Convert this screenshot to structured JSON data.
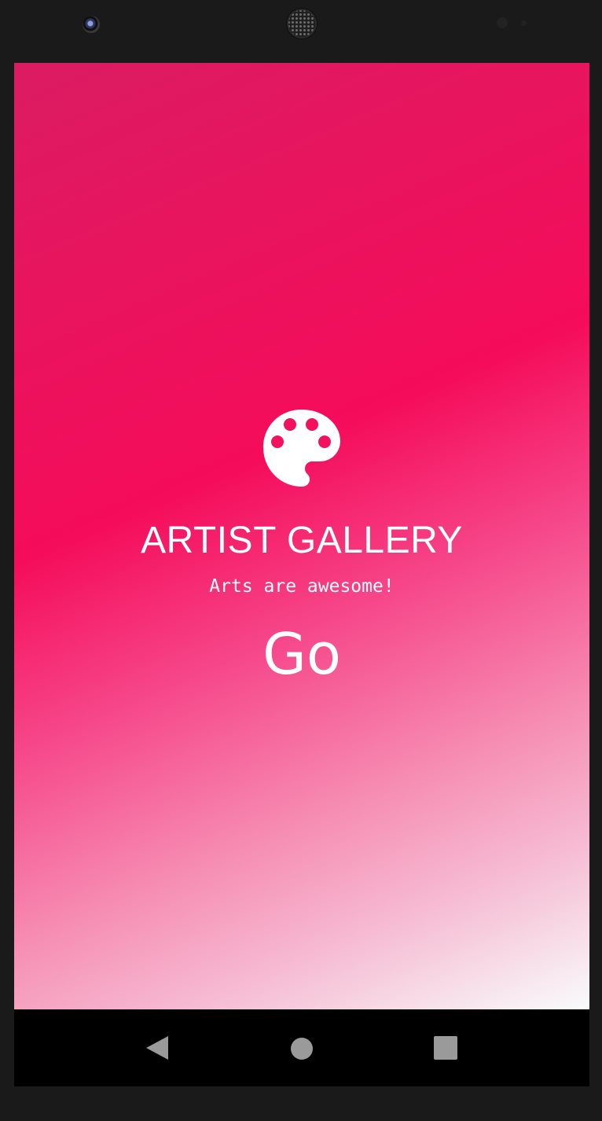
{
  "app": {
    "title": "ARTIST GALLERY",
    "subtitle": "Arts are awesome!",
    "go_label": "Go",
    "logo_icon": "palette-icon"
  },
  "colors": {
    "gradient_start": "#db1c62",
    "gradient_mid": "#f50c5a",
    "gradient_end": "#f8fbfb",
    "text": "#ffffff",
    "navbar": "#000000",
    "nav_icons": "#9a9a9a"
  },
  "navigation_bar": {
    "back_icon": "back-triangle-icon",
    "home_icon": "home-circle-icon",
    "recents_icon": "recents-square-icon"
  }
}
